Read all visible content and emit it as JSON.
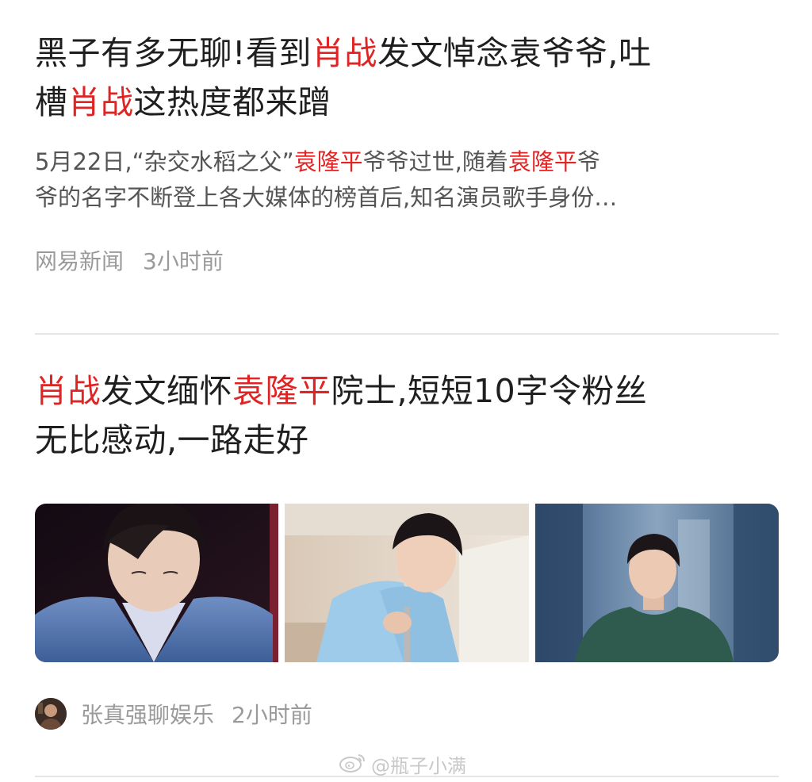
{
  "article1": {
    "title": {
      "p1": "黑子有多无聊!看到",
      "h1": "肖战",
      "p2": "发文悼念袁爷爷,吐",
      "p3": "槽",
      "h2": "肖战",
      "p4": "这热度都来蹭"
    },
    "summary": {
      "s1": "5月22日,“杂交水稻之父”",
      "h1": "袁隆平",
      "s2": "爷爷过世,随着",
      "h2": "袁隆平",
      "s3": "爷",
      "s4": "爷的名字不断登上各大媒体的榜首后,知名演员歌手身份…"
    },
    "source": "网易新闻",
    "time": "3小时前"
  },
  "article2": {
    "title": {
      "h1": "肖战",
      "p1": "发文缅怀",
      "h2": "袁隆平",
      "p2": "院士,短短10字令粉丝",
      "p3": "无比感动,一路走好"
    },
    "thumbnails": [
      "photo-denim-jacket",
      "photo-light-blue-shirt",
      "photo-green-sweater"
    ],
    "author": "张真强聊娱乐",
    "time": "2小时前"
  },
  "watermark": {
    "icon": "weibo-icon",
    "text": "@瓶子小满"
  },
  "colors": {
    "highlight": "#e02424",
    "title": "#1f1f1f",
    "summary": "#555555",
    "meta": "#9a9a9a",
    "divider": "#e6e6e6"
  }
}
